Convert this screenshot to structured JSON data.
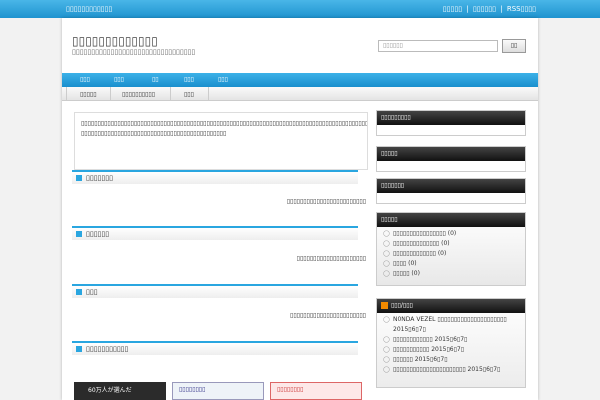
{
  "topbar": {
    "left": "▯▯▯▯▯▯▯▯▯▯▯▯",
    "right_links": [
      "▯▯▯▯▯",
      "|",
      "▯▯▯▯▯▯",
      "|",
      "RSS▯▯▯▯"
    ]
  },
  "header": {
    "title": "▯▯▯▯▯▯▯▯▯▯▯▯▯",
    "description": "▯▯▯▯▯▯▯▯▯▯▯▯▯▯▯▯▯▯▯▯▯▯▯▯▯▯▯▯▯▯▯▯",
    "search_placeholder": "▯▯▯▯▯▯",
    "search_button": "▯▯"
  },
  "nav": {
    "items": [
      "▯▯▯",
      "▯▯▯",
      "▯▯",
      "▯▯▯",
      "▯▯▯"
    ]
  },
  "subnav": {
    "items": [
      "▯▯▯▯▯",
      "▯▯▯▯▯▯▯▯▯▯",
      "▯▯▯"
    ]
  },
  "intro": "▯▯▯▯▯▯▯▯▯▯▯▯▯▯▯▯▯▯▯▯▯▯▯▯▯▯▯▯▯▯▯▯▯▯▯▯▯▯▯▯▯▯▯▯▯▯▯▯▯▯▯▯▯▯▯▯▯▯▯▯▯▯▯▯▯▯▯▯▯▯▯▯▯▯▯▯▯▯▯▯▯▯▯▯▯▯▯▯▯▯▯▯▯▯▯▯▯▯▯▯▯▯▯▯▯▯▯▯▯▯▯▯▯▯▯▯▯▯▯▯▯▯ ▯▯▯▯▯▯▯▯▯▯▯▯▯▯▯▯▯▯▯▯▯▯▯▯▯▯▯▯▯▯▯▯▯▯▯▯▯▯▯▯▯▯▯▯",
  "sections": [
    {
      "title": "▯▯▯▯▯▯▯",
      "text": "▯▯▯▯▯▯▯▯▯▯▯▯▯▯▯▯▯▯▯▯▯▯▯▯"
    },
    {
      "title": "▯▯▯▯▯▯",
      "text": "▯▯▯▯▯▯▯▯▯▯▯▯▯▯▯▯▯▯▯▯▯"
    },
    {
      "title": "▯▯▯",
      "text": "▯▯▯▯▯▯▯▯▯▯▯▯▯▯▯▯▯▯▯▯▯▯▯"
    },
    {
      "title": "▯▯▯▯▯▯▯▯▯▯▯",
      "text": ""
    }
  ],
  "thumbs": [
    {
      "caption": "60万人が選んだ"
    },
    {
      "caption": "▯▯▯▯▯▯▯▯"
    },
    {
      "caption": "▯▯▯▯▯▯▯▯"
    }
  ],
  "sidebar": {
    "box1": "▯▯▯▯▯▯▯▯▯",
    "box2": "▯▯▯▯▯",
    "box3": "▯▯▯▯▯▯▯",
    "categories_title": "▯▯▯▯▯",
    "categories": [
      "▯▯▯▯▯▯▯▯▯▯▯▯▯▯▯▯ (0)",
      "▯▯▯▯▯▯▯▯▯▯▯▯▯▯ (0)",
      "▯▯▯▯▯▯▯▯▯▯▯▯▯ (0)",
      "▯▯▯▯ (0)",
      "▯▯▯▯▯ (0)"
    ],
    "rss_title": "▯▯▯/▯▯▯",
    "rss_items": [
      "N0NDA VEZEL ▯▯▯▯▯▯▯▯▯▯▯▯▯▯▯▯▯▯▯▯▯ 2015▯6▯7▯",
      "▯▯▯▯▯▯▯▯▯▯▯▯ 2015▯6▯7▯",
      "▯▯▯▯▯▯▯▯▯▯▯ 2015▯6▯7▯",
      "▯▯▯▯▯▯ 2015▯6▯7▯",
      "▯▯▯▯▯▯▯▯▯▯▯▯▯▯▯▯▯▯▯▯▯▯ 2015▯6▯7▯"
    ]
  }
}
